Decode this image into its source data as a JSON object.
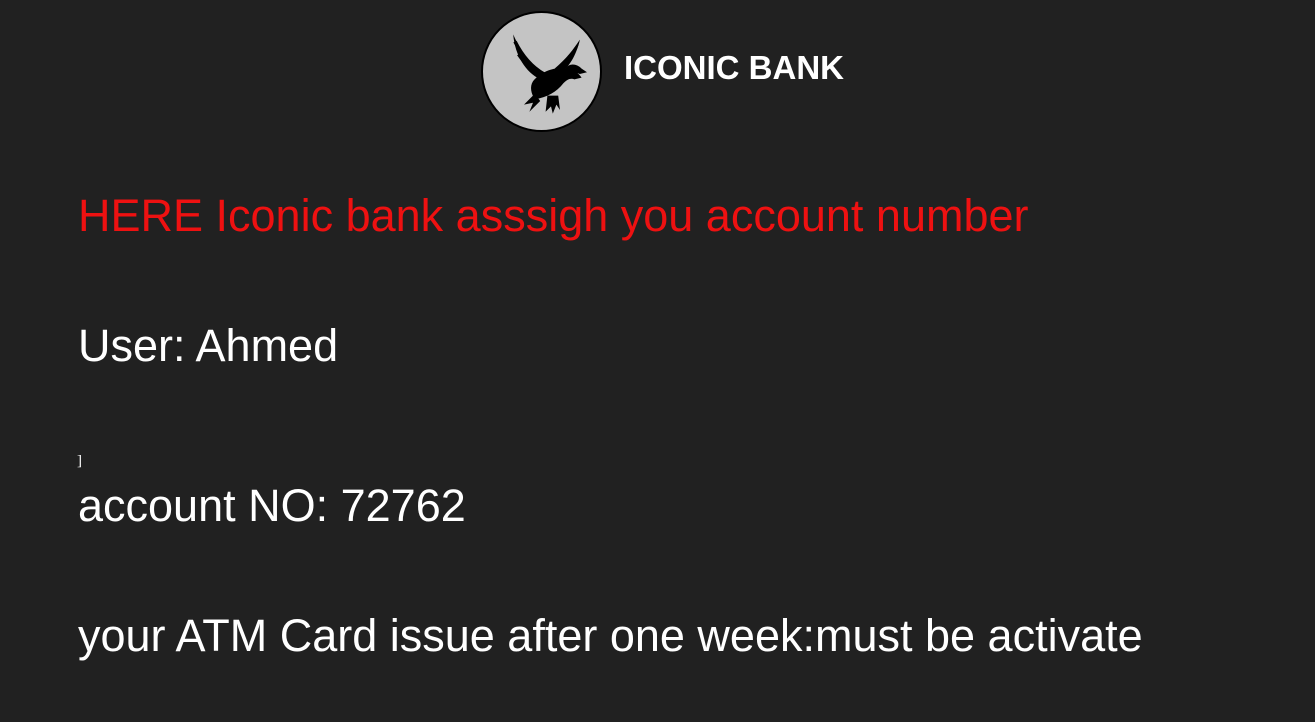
{
  "header": {
    "logo_icon": "eagle-icon",
    "brand_name": "ICONIC BANK"
  },
  "main": {
    "headline": "HERE Iconic bank asssigh you account number",
    "user_line": "User: Ahmed",
    "stray_char": "]",
    "account_line": "account NO: 72762",
    "atm_line": "your ATM Card issue after one week:must be activate"
  },
  "colors": {
    "background": "#212121",
    "headline": "#ee1111",
    "text": "#ffffff",
    "logo_circle": "#c4c4c4"
  }
}
